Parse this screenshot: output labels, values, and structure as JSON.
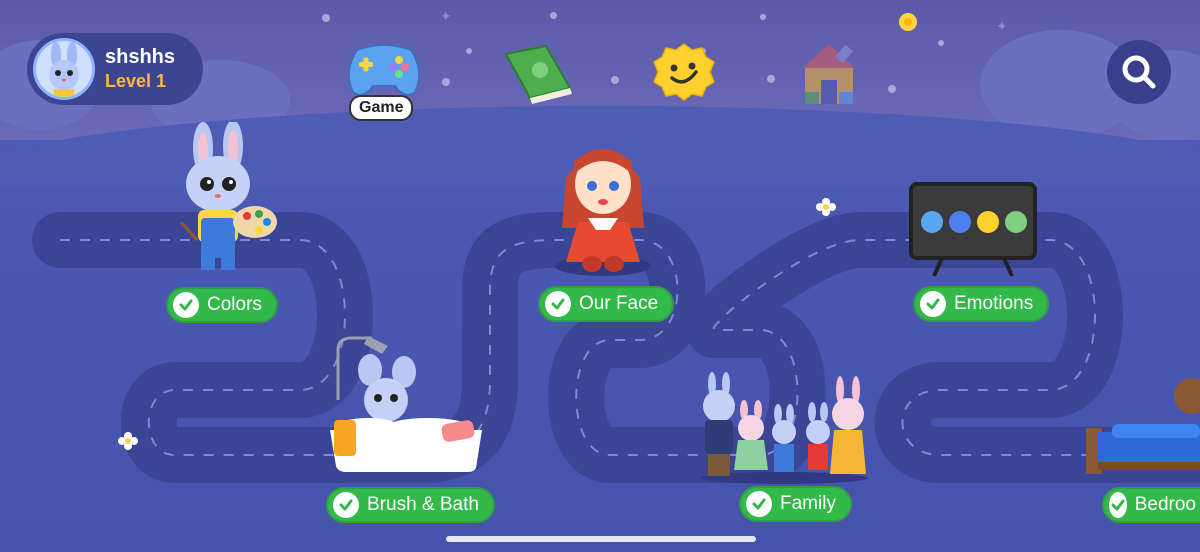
{
  "profile": {
    "username": "shshhs",
    "level": "Level 1"
  },
  "nav": {
    "game_label": "Game",
    "icons": [
      "gamepad-icon",
      "book-icon",
      "smile-badge-icon",
      "toy-house-icon",
      "search-icon"
    ]
  },
  "lessons": [
    {
      "label": "Colors",
      "completed": true
    },
    {
      "label": "Our Face",
      "completed": true
    },
    {
      "label": "Emotions",
      "completed": true
    },
    {
      "label": "Brush & Bath",
      "completed": true
    },
    {
      "label": "Family",
      "completed": true
    },
    {
      "label": "Bedroo",
      "completed": true
    }
  ],
  "colors": {
    "pill": "#33b84a",
    "level": "#ffb83a",
    "road": "#3a4596",
    "background": "#4b58b2"
  }
}
